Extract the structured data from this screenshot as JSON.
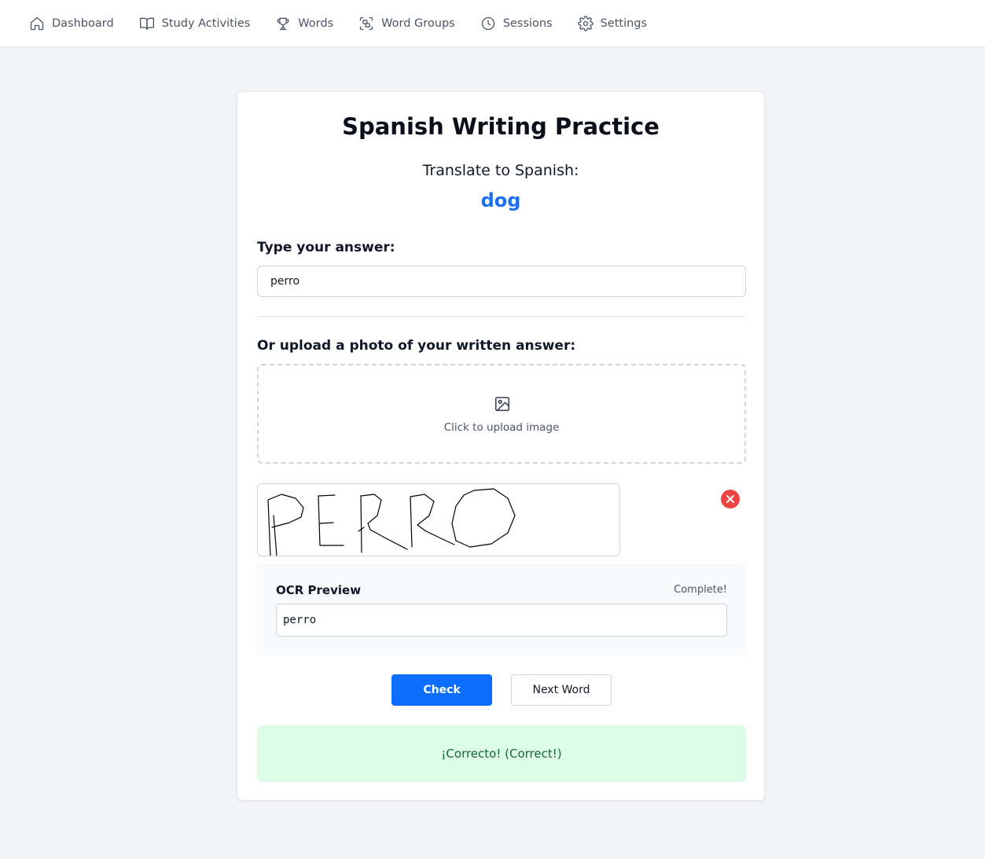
{
  "nav": {
    "items": [
      {
        "label": "Dashboard",
        "icon": "home-icon"
      },
      {
        "label": "Study Activities",
        "icon": "book-open-icon"
      },
      {
        "label": "Words",
        "icon": "trophy-icon"
      },
      {
        "label": "Word Groups",
        "icon": "scan-group-icon"
      },
      {
        "label": "Sessions",
        "icon": "clock-icon"
      },
      {
        "label": "Settings",
        "icon": "gear-icon"
      }
    ]
  },
  "practice": {
    "title": "Spanish Writing Practice",
    "prompt": "Translate to Spanish:",
    "word": "dog",
    "word_color": "#1d6ff2"
  },
  "answer": {
    "label": "Type your answer:",
    "value": "perro"
  },
  "upload": {
    "label": "Or upload a photo of your written answer:",
    "dropzone_text": "Click to upload image",
    "icon": "image-icon",
    "preview_text": "PERRO",
    "remove_icon": "close-icon"
  },
  "ocr": {
    "title": "OCR Preview",
    "status": "Complete!",
    "value": "perro"
  },
  "actions": {
    "check_label": "Check",
    "next_label": "Next Word",
    "primary_color": "#0d6efd"
  },
  "result": {
    "message": "¡Correcto! (Correct!)",
    "bg_color": "#dcfce7",
    "text_color": "#166534"
  }
}
